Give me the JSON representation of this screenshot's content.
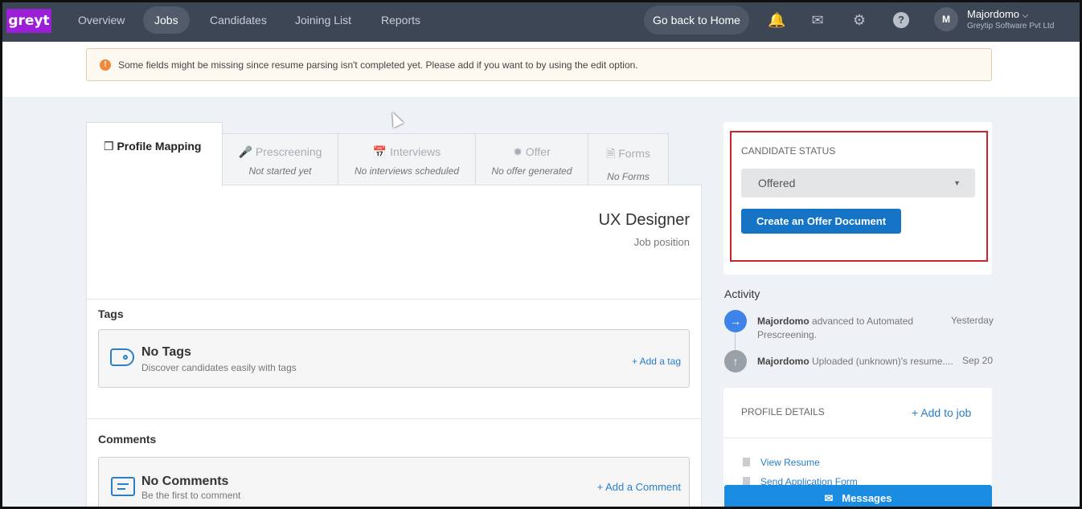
{
  "nav": {
    "logo": "greyt",
    "items": [
      "Overview",
      "Jobs",
      "Candidates",
      "Joining List",
      "Reports"
    ],
    "active": "Jobs",
    "home_button": "Go back to Home",
    "icons": [
      "bell-icon",
      "mail-icon",
      "gear-icon",
      "help-icon"
    ],
    "avatar_initial": "M",
    "user_name": "Majordomo",
    "user_org": "Greytip Software Pvt Ltd"
  },
  "warning": {
    "text": "Some fields might be missing since resume parsing isn't completed yet. Please add if you want to by using the edit option."
  },
  "tabs": {
    "active": "Profile Mapping",
    "items": [
      {
        "title": "Prescreening",
        "subtitle": "Not started yet"
      },
      {
        "title": "Interviews",
        "subtitle": "No interviews scheduled"
      },
      {
        "title": "Offer",
        "subtitle": "No offer generated"
      },
      {
        "title": "Forms",
        "subtitle": "No Forms"
      }
    ]
  },
  "job": {
    "title": "UX Designer",
    "subtitle": "Job position"
  },
  "tags": {
    "label": "Tags",
    "title": "No Tags",
    "subtitle": "Discover candidates easily with tags",
    "link": "+ Add a tag"
  },
  "comments": {
    "label": "Comments",
    "title": "No Comments",
    "subtitle": "Be the first to comment",
    "link": "+ Add a Comment"
  },
  "status": {
    "label": "CANDIDATE STATUS",
    "value": "Offered",
    "button": "Create an Offer Document"
  },
  "activity": {
    "label": "Activity",
    "items": [
      {
        "actor": "Majordomo",
        "text": "advanced to Automated Prescreening.",
        "time": "Yesterday"
      },
      {
        "actor": "Majordomo",
        "text": "Uploaded (unknown)'s resume....",
        "time": "Sep 20"
      }
    ]
  },
  "profile_details": {
    "label": "PROFILE DETAILS",
    "add_link": "+ Add to job",
    "links": [
      "View Resume",
      "Send Application Form"
    ]
  },
  "messages_button": "Messages",
  "colors": {
    "nav_bg": "#3d4655",
    "accent": "#1674c6",
    "logo": "#9b1fd6",
    "highlight": "#d0202a"
  }
}
